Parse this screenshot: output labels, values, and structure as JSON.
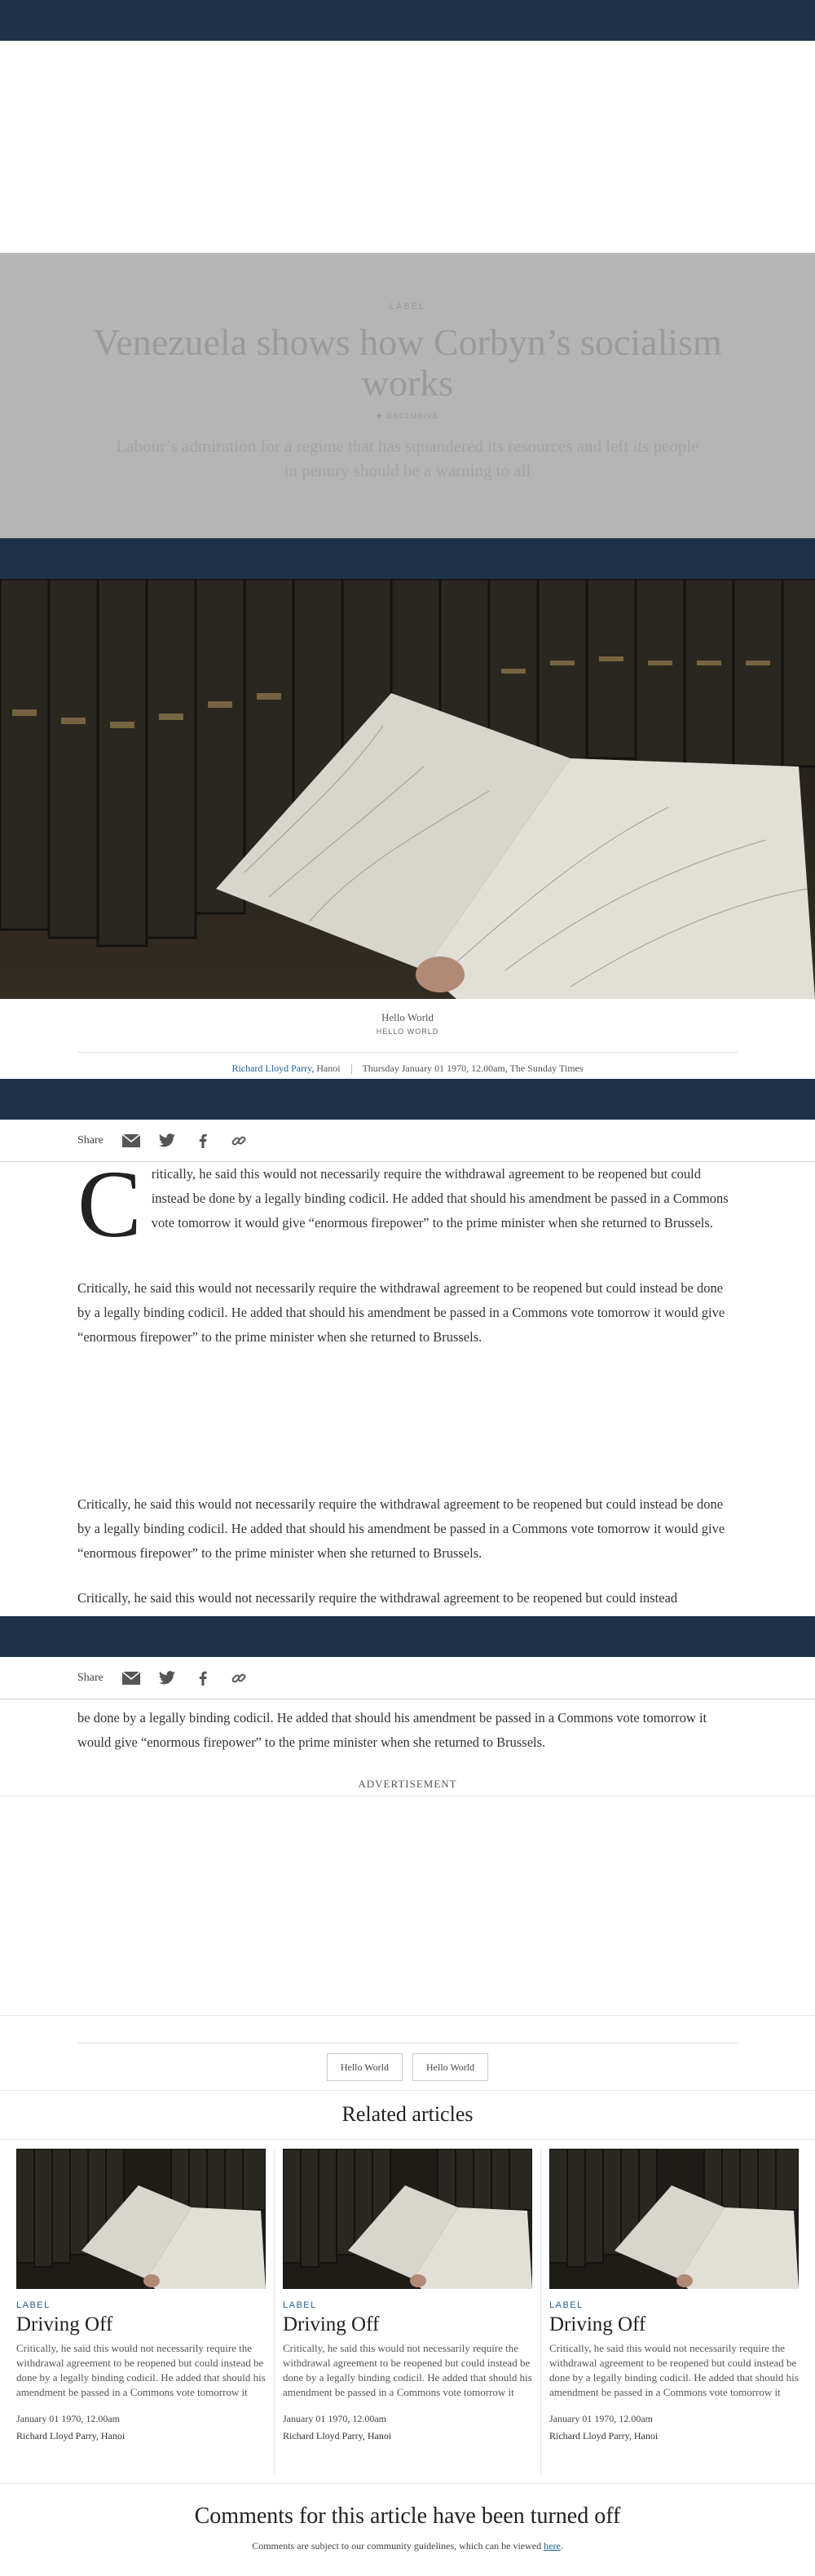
{
  "article": {
    "label": "LABEL",
    "headline": "Venezuela shows how Corbyn’s socialism works",
    "exclusive": "★ EXCLUSIVE",
    "standfirst": "Labour’s admiration for a regime that has squandered its resources and left its people in penury should be a warning to all",
    "image_caption": "Hello World",
    "image_credit": "HELLO WORLD",
    "author": "Richard Lloyd Parry",
    "location": ", Hanoi",
    "dateline": "Thursday January 01 1970, 12.00am, The Sunday Times",
    "dropcap": "C",
    "paragraph_first": "ritically, he said this would not necessarily require the withdrawal agreement to be reopened but could instead be done by a legally binding codicil. He added that should his amendment be passed in a Commons vote tomorrow it would give “enormous firepower” to the prime minister when she returned to Brussels.",
    "paragraph": "Critically, he said this would not necessarily require the withdrawal agreement to be reopened but could instead be done by a legally binding codicil. He added that should his amendment be passed in a Commons vote tomorrow it would give “enormous firepower” to the prime minister when she returned to Brussels.",
    "paragraph_partial_top": "Critically, he said this would not necessarily require the withdrawal agreement to be reopened but could instead",
    "paragraph_partial_bottom": "be done by a legally binding codicil. He added that should his amendment be passed in a Commons vote tomorrow it would give “enormous firepower” to the prime minister when she returned to Brussels."
  },
  "share": {
    "label": "Share"
  },
  "advertisement": {
    "label": "ADVERTISEMENT"
  },
  "tags": [
    "Hello World",
    "Hello World"
  ],
  "related": {
    "title": "Related articles",
    "cards": [
      {
        "label": "LABEL",
        "title": "Driving Off",
        "text": "Critically, he said this would not necessarily require the withdrawal agreement to be reopened but could instead be done by a legally binding codicil. He added that should his amendment be passed in a Commons vote tomorrow it would give “enormous firepower” to the prime minister when she returned to Brussels....",
        "date": "January 01 1970, 12.00am",
        "author": "Richard Lloyd Parry, Hanoi"
      },
      {
        "label": "LABEL",
        "title": "Driving Off",
        "text": "Critically, he said this would not necessarily require the withdrawal agreement to be reopened but could instead be done by a legally binding codicil. He added that should his amendment be passed in a Commons vote tomorrow it would give “enormous firepower” to the prime minister when she returned to Brussels....",
        "date": "January 01 1970, 12.00am",
        "author": "Richard Lloyd Parry, Hanoi"
      },
      {
        "label": "LABEL",
        "title": "Driving Off",
        "text": "Critically, he said this would not necessarily require the withdrawal agreement to be reopened but could instead be done by a legally binding codicil. He added that should his amendment be passed in a Commons vote tomorrow it would give “enormous firepower” to the prime minister when she returned to Brussels....",
        "date": "January 01 1970, 12.00am",
        "author": "Richard Lloyd Parry, Hanoi"
      }
    ]
  },
  "comments": {
    "title": "Comments for this article have been turned off",
    "note": "Comments are subject to our community guidelines, which can be viewed ",
    "link": "here",
    "end": "."
  },
  "colors": {
    "navbar": "#1f3149",
    "accent": "#1f5f95",
    "hero": "#b5b5b5"
  },
  "icons": [
    "envelope-icon",
    "twitter-icon",
    "facebook-icon",
    "link-icon"
  ]
}
